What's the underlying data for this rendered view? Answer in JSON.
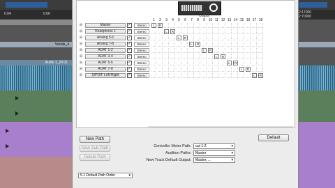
{
  "daw": {
    "left_timeline": [
      "0:04",
      "0:06"
    ],
    "left_region": "Vocals_4",
    "left_clip": "Audio 1_23 01",
    "right_timeline": [
      "2:17000",
      "2:70000"
    ]
  },
  "grid_header": {
    "output_label": "Output",
    "columns": [
      "1",
      "2",
      "3",
      "4",
      "5",
      "6",
      "7",
      "8",
      "9",
      "10",
      "11",
      "12",
      "13",
      "14",
      "15",
      "16",
      "17",
      "18"
    ]
  },
  "paths": [
    {
      "name": "Master",
      "format": "Stereo",
      "cells": {
        "1": "L",
        "2": "R"
      }
    },
    {
      "name": "Headphone 1",
      "format": "Stereo",
      "cells": {
        "3": "L",
        "4": "R"
      }
    },
    {
      "name": "Analog 5-6",
      "format": "Stereo",
      "cells": {
        "5": "L",
        "6": "R"
      }
    },
    {
      "name": "Analog 7-8",
      "format": "Stereo",
      "cells": {
        "7": "L",
        "8": "R"
      }
    },
    {
      "name": "ADAT 1-2",
      "format": "Stereo",
      "cells": {
        "9": "L",
        "10": "R"
      }
    },
    {
      "name": "ADAT 3-4",
      "format": "Stereo",
      "cells": {
        "11": "L",
        "12": "R"
      }
    },
    {
      "name": "ADAT 5-6",
      "format": "Stereo",
      "cells": {
        "13": "L",
        "14": "R"
      }
    },
    {
      "name": "ADAT 7-8",
      "format": "Stereo",
      "cells": {
        "15": "L",
        "16": "R"
      }
    },
    {
      "name": "S/PDIF Left-Right",
      "format": "Stereo",
      "cells": {
        "17": "L",
        "18": "R"
      }
    }
  ],
  "buttons": {
    "new_path": "New Path",
    "new_sub_path": "New Sub Path",
    "delete_path": "Delete Path",
    "default": "Default"
  },
  "settings": {
    "controller_meter_label": "Controller Meter Path:",
    "controller_meter_value": "out 1-2",
    "audition_label": "Audition Paths:",
    "audition_value": "Master",
    "new_track_label": "New Track Default Output:",
    "new_track_value": "Master, ..."
  },
  "path_order": "5.1 Default Path Order"
}
